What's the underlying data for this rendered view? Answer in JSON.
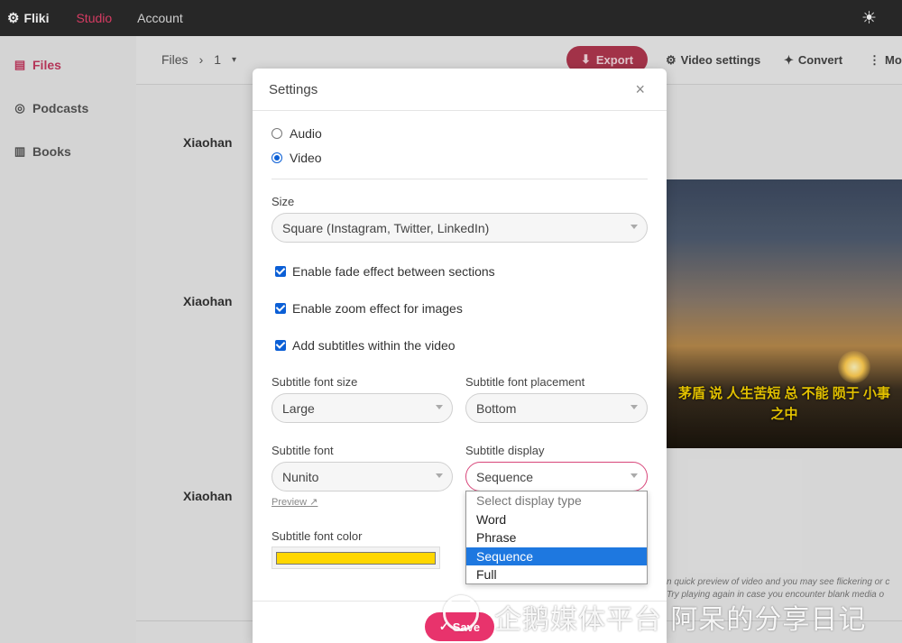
{
  "topnav": {
    "brand": "Fliki",
    "links": [
      "Studio",
      "Account"
    ]
  },
  "sidebar": {
    "items": [
      {
        "label": "Files",
        "icon": "file-icon",
        "active": true
      },
      {
        "label": "Podcasts",
        "icon": "podcast-icon",
        "active": false
      },
      {
        "label": "Books",
        "icon": "book-icon",
        "active": false
      }
    ]
  },
  "toolbar": {
    "breadcrumb_root": "Files",
    "breadcrumb_sep": "›",
    "breadcrumb_current": "1",
    "export_label": "Export",
    "video_settings_label": "Video settings",
    "convert_label": "Convert",
    "more_label": "Mor"
  },
  "rows": [
    {
      "author": "Xiaohan"
    },
    {
      "author": "Xiaohan"
    },
    {
      "author": "Xiaohan"
    }
  ],
  "video": {
    "caption_line1": "茅盾 说 人生苦短 总 不能 陨于 小事",
    "caption_line2": "之中"
  },
  "hints": {
    "line1": "n quick preview of video and you may see flickering or c",
    "line2": "Try playing again in case you encounter blank media o"
  },
  "modal": {
    "title": "Settings",
    "close": "×",
    "media_options": [
      {
        "label": "Audio",
        "selected": false
      },
      {
        "label": "Video",
        "selected": true
      }
    ],
    "size_label": "Size",
    "size_value": "Square (Instagram, Twitter, LinkedIn)",
    "checkboxes": [
      {
        "label": "Enable fade effect between sections",
        "checked": true
      },
      {
        "label": "Enable zoom effect for images",
        "checked": true
      },
      {
        "label": "Add subtitles within the video",
        "checked": true
      }
    ],
    "subtitle_font_size_label": "Subtitle font size",
    "subtitle_font_size_value": "Large",
    "subtitle_font_placement_label": "Subtitle font placement",
    "subtitle_font_placement_value": "Bottom",
    "subtitle_font_label": "Subtitle font",
    "subtitle_font_value": "Nunito",
    "preview_link": "Preview ↗",
    "subtitle_display_label": "Subtitle display",
    "subtitle_display_value": "Sequence",
    "subtitle_font_color_label": "Subtitle font color",
    "subtitle_font_color": "#ffd700",
    "save_label": "Save"
  },
  "dropdown": {
    "options": [
      {
        "label": "Select display type",
        "state": "placeholder"
      },
      {
        "label": "Word",
        "state": ""
      },
      {
        "label": "Phrase",
        "state": ""
      },
      {
        "label": "Sequence",
        "state": "selected"
      },
      {
        "label": "Full",
        "state": ""
      }
    ]
  },
  "watermark": {
    "text": "企鹅媒体平台 阿呆的分享日记"
  },
  "colors": {
    "accent": "#e8336c",
    "topnav_bg": "#2b2b2b",
    "checkbox": "#0b5fd6",
    "dropdown_selected": "#1e78e0"
  }
}
